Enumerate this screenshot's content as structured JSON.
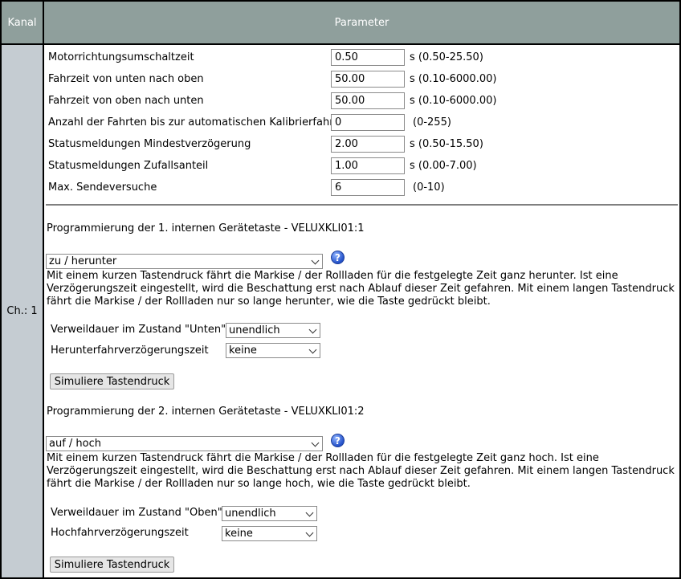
{
  "header": {
    "kanal": "Kanal",
    "parameter": "Parameter"
  },
  "channel": {
    "label": "Ch.: 1"
  },
  "params": [
    {
      "label": "Motorrichtungsumschaltzeit",
      "value": "0.50",
      "range": "s (0.50-25.50)"
    },
    {
      "label": "Fahrzeit von unten nach oben",
      "value": "50.00",
      "range": "s (0.10-6000.00)"
    },
    {
      "label": "Fahrzeit von oben nach unten",
      "value": "50.00",
      "range": "s (0.10-6000.00)"
    },
    {
      "label": "Anzahl der Fahrten bis zur automatischen Kalibrierfahrt",
      "value": "0",
      "range": "(0-255)"
    },
    {
      "label": "Statusmeldungen Mindestverzögerung",
      "value": "2.00",
      "range": "s (0.50-15.50)"
    },
    {
      "label": "Statusmeldungen Zufallsanteil",
      "value": "1.00",
      "range": "s (0.00-7.00)"
    },
    {
      "label": "Max. Sendeversuche",
      "value": "6",
      "range": "(0-10)"
    }
  ],
  "button1": {
    "title": "Programmierung der 1. internen Gerätetaste - VELUXKLI01:1",
    "mode": "zu / herunter",
    "description": "Mit einem kurzen Tastendruck fährt die Markise / der Rollladen für die festgelegte Zeit ganz herunter. Ist eine Verzögerungszeit eingestellt, wird die Beschattung erst nach Ablauf dieser Zeit gefahren. Mit einem langen Tastendruck fährt die Markise / der Rollladen nur so lange herunter, wie die Taste gedrückt bleibt.",
    "dwell_label": "Verweildauer im Zustand \"Unten\"",
    "dwell_value": "unendlich",
    "delay_label": "Herunterfahrverzögerungszeit",
    "delay_value": "keine",
    "simulate_label": "Simuliere Tastendruck"
  },
  "button2": {
    "title": "Programmierung der 2. internen Gerätetaste - VELUXKLI01:2",
    "mode": "auf / hoch",
    "description": "Mit einem kurzen Tastendruck fährt die Markise / der Rollladen für die festgelegte Zeit ganz hoch. Ist eine Verzögerungszeit eingestellt, wird die Beschattung erst nach Ablauf dieser Zeit gefahren. Mit einem langen Tastendruck fährt die Markise / der Rollladen nur so lange hoch, wie die Taste gedrückt bleibt.",
    "dwell_label": "Verweildauer im Zustand \"Oben\"",
    "dwell_value": "unendlich",
    "delay_label": "Hochfahrverzögerungszeit",
    "delay_value": "keine",
    "simulate_label": "Simuliere Tastendruck"
  },
  "help_icon": "?"
}
